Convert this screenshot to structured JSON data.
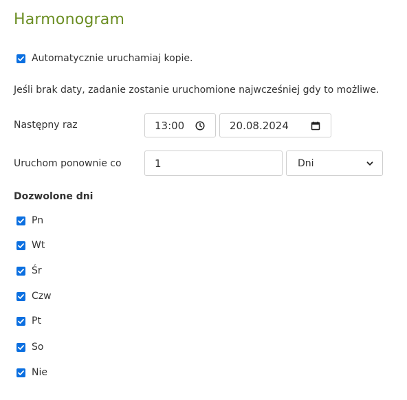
{
  "title": "Harmonogram",
  "auto_run": {
    "label": "Automatycznie uruchamiaj kopie.",
    "checked": true
  },
  "info_text": "Jeśli brak daty, zadanie zostanie uruchomione najwcześniej gdy to możliwe.",
  "next_run": {
    "label": "Następny raz",
    "time": "13:00",
    "date": "20.08.2024"
  },
  "repeat": {
    "label": "Uruchom ponownie co",
    "value": "1",
    "unit_selected": "Dni"
  },
  "allowed_days": {
    "title": "Dozwolone dni",
    "days": [
      {
        "label": "Pn",
        "checked": true
      },
      {
        "label": "Wt",
        "checked": true
      },
      {
        "label": "Śr",
        "checked": true
      },
      {
        "label": "Czw",
        "checked": true
      },
      {
        "label": "Pt",
        "checked": true
      },
      {
        "label": "So",
        "checked": true
      },
      {
        "label": "Nie",
        "checked": true
      }
    ]
  },
  "colors": {
    "title": "#6b8e23",
    "checkbox": "#0b6fe0"
  },
  "icons": {
    "time": "clock-icon",
    "date": "calendar-icon",
    "select": "chevron-down-icon",
    "checkbox": "checkmark-icon"
  }
}
